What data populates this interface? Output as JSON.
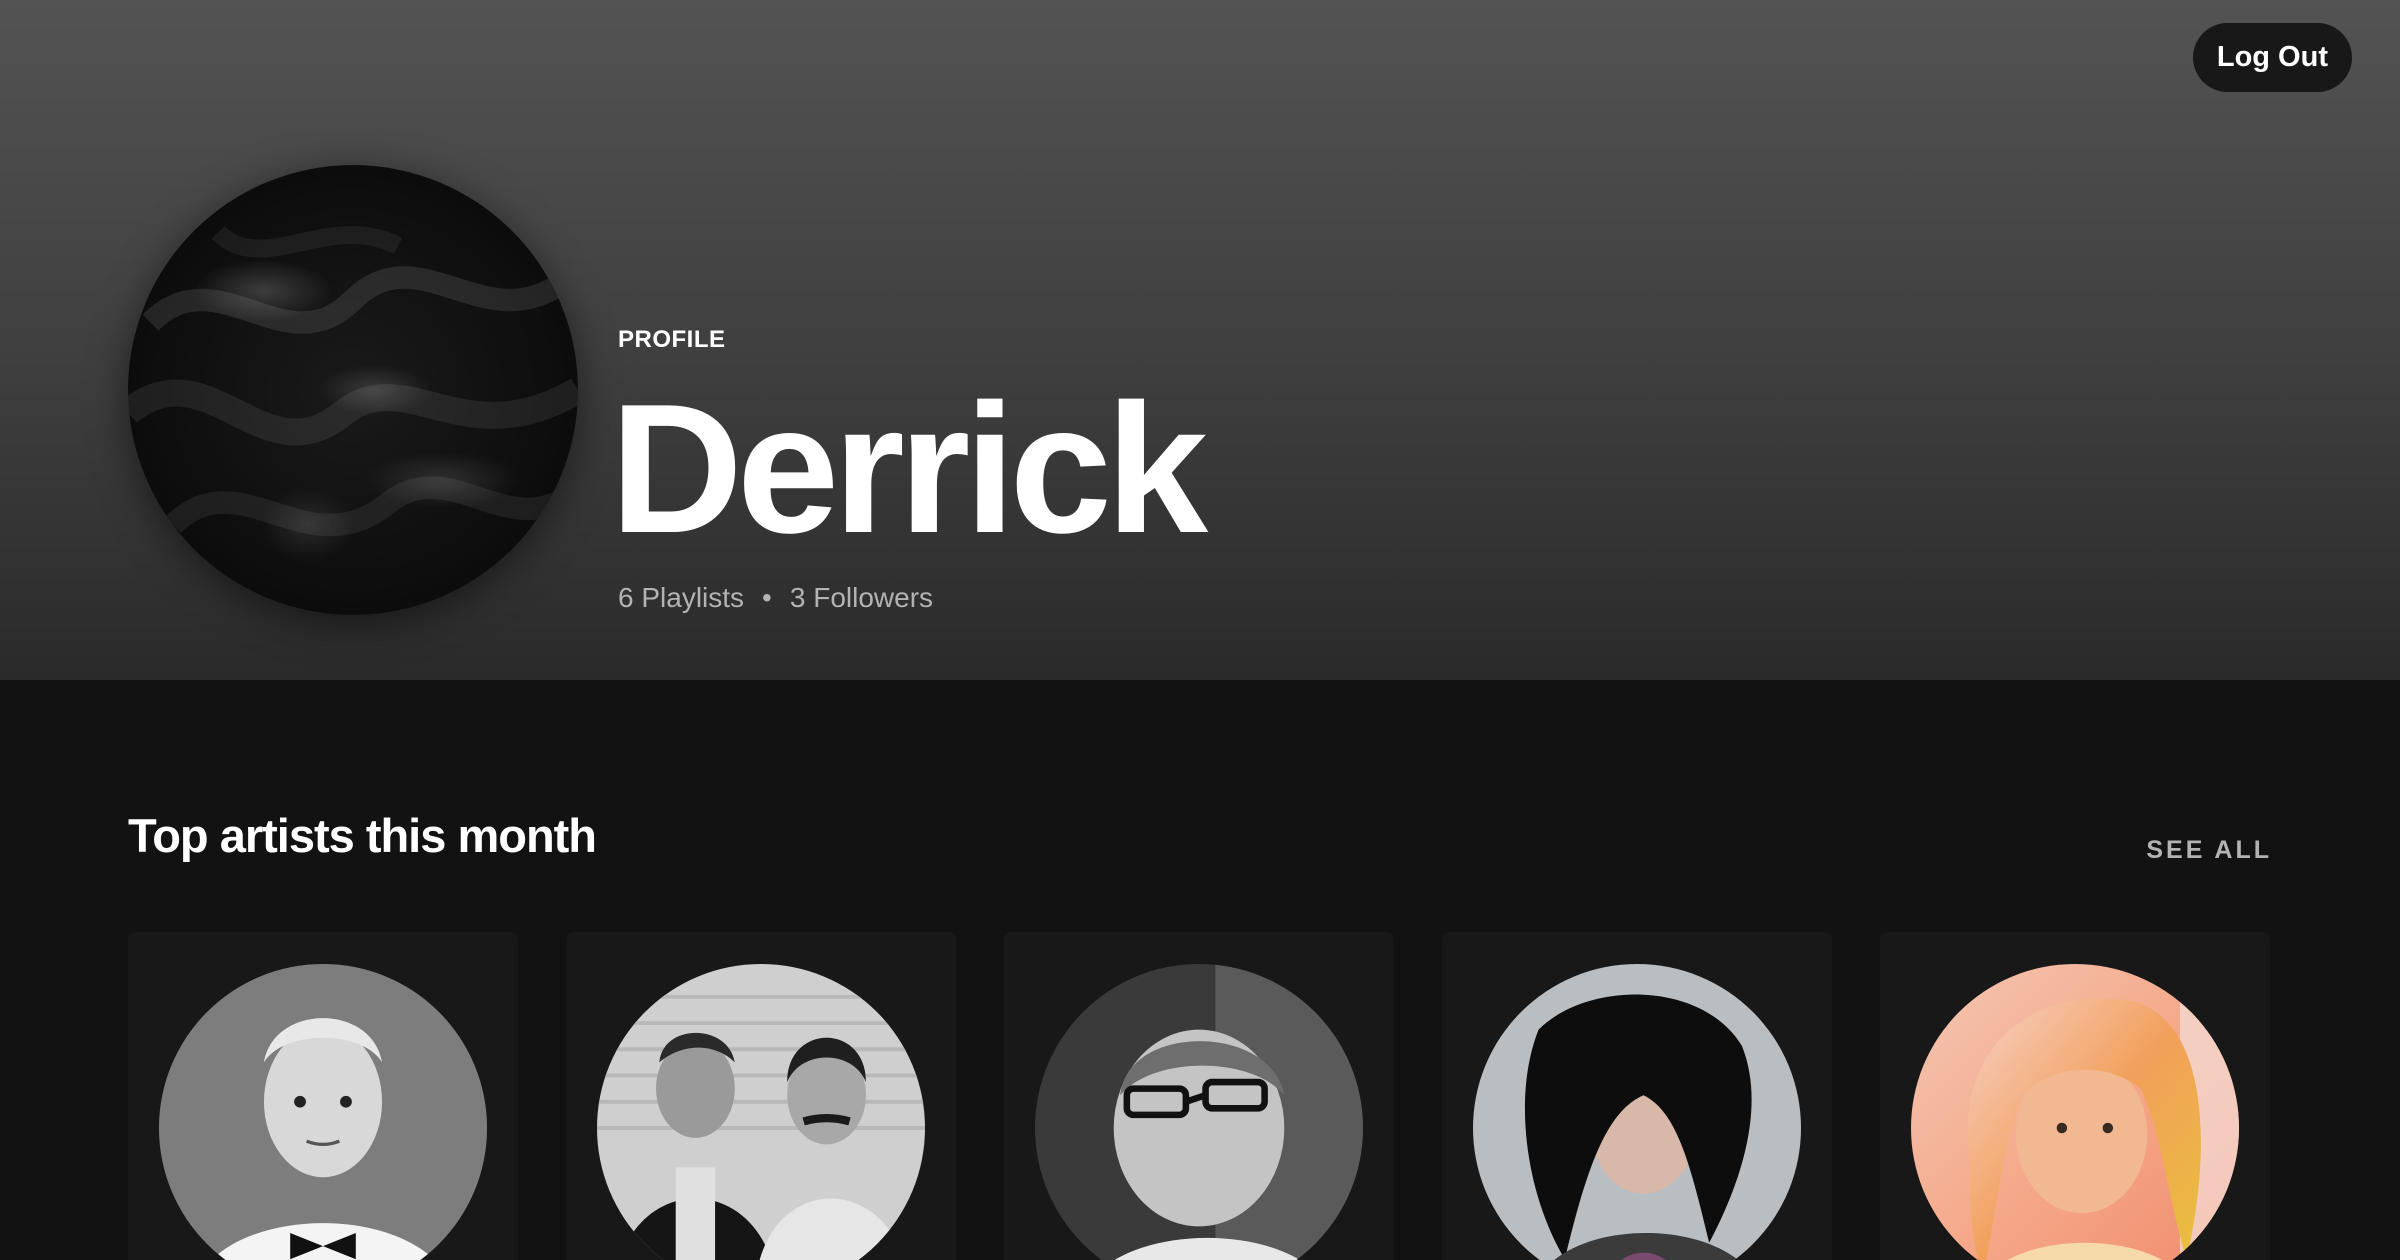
{
  "header": {
    "logout_label": "Log Out",
    "profile_label": "PROFILE",
    "name": "Derrick",
    "playlists": "6 Playlists",
    "separator": "•",
    "followers": "3 Followers"
  },
  "section": {
    "title": "Top artists this month",
    "see_all_label": "SEE ALL"
  },
  "artists": [
    {
      "image": "bw-portrait-conductor"
    },
    {
      "image": "bw-portrait-duo"
    },
    {
      "image": "bw-portrait-glasses"
    },
    {
      "image": "portrait-long-dark-hair"
    },
    {
      "image": "portrait-colored-hair"
    }
  ],
  "colors": {
    "background": "#121212",
    "card": "#181818",
    "header_top": "#535353",
    "muted_text": "#b3b3b3"
  }
}
